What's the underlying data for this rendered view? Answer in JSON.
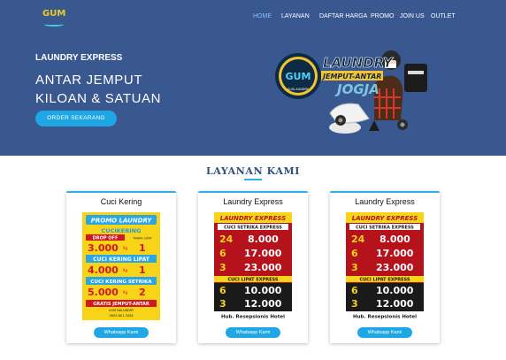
{
  "brand": {
    "logo_text": "GUM"
  },
  "nav": {
    "items": [
      {
        "label": "HOME",
        "active": true
      },
      {
        "label": "LAYANAN",
        "active": false
      },
      {
        "label": "DAFTAR HARGA",
        "active": false
      },
      {
        "label": "PROMO",
        "active": false
      },
      {
        "label": "JOIN US",
        "active": false
      },
      {
        "label": "OUTLET",
        "active": false
      }
    ]
  },
  "hero": {
    "subtitle": "LAUNDRY EXPRESS",
    "title": "ANTAR JEMPUT KILOAN & SATUAN",
    "cta_label": "ORDER SEKARANG",
    "illustration": {
      "badge_top": "GUM",
      "badge_bottom": "SUSLAUNDRY",
      "line1": "LAUNDRY",
      "line2": "JEMPUT-ANTAR",
      "line3": "JOGJA"
    }
  },
  "section": {
    "title": "LAYANAN KAMI"
  },
  "cards": [
    {
      "title": "Cuci Kering",
      "button": "Whatsapp Kami",
      "flyer": {
        "header": "PROMO LAUNDRY",
        "rows": [
          {
            "label": "CUCIKERING",
            "sub": "DROP OFF",
            "note": "TANPA LIPAT",
            "price": "3.000",
            "unit": "Kg",
            "min": "1"
          },
          {
            "label": "CUCI KERING LIPAT",
            "price": "4.000",
            "unit": "Kg",
            "min": "1"
          },
          {
            "label": "CUCI KERING SETRIKA",
            "price": "5.000",
            "unit": "Kg",
            "min": "2"
          }
        ],
        "footer": "GRATIS JEMPUT-ANTAR",
        "footer2": "GUM NALUNDRY",
        "phone": "0853-801-3426"
      }
    },
    {
      "title": "Laundry Express",
      "button": "Whatsapp Kami",
      "flyer": {
        "header": "LAUNDRY EXPRESS",
        "banner": "CUCI SETRIKA EXPRESS",
        "rows": [
          {
            "hours": "24",
            "price": "8.000"
          },
          {
            "hours": "6",
            "price": "17.000"
          },
          {
            "hours": "3",
            "price": "23.000"
          }
        ],
        "banner2": "CUCI LIPAT EXPRESS",
        "rows2": [
          {
            "hours": "6",
            "price": "10.000"
          },
          {
            "hours": "3",
            "price": "12.000"
          }
        ],
        "footer": "Hub. Resepsionis Hotel"
      }
    },
    {
      "title": "Laundry Express",
      "button": "Whatsapp Kami",
      "flyer": {
        "header": "LAUNDRY EXPRESS",
        "banner": "CUCI SETRIKA EXPRESS",
        "rows": [
          {
            "hours": "24",
            "price": "8.000"
          },
          {
            "hours": "6",
            "price": "17.000"
          },
          {
            "hours": "3",
            "price": "23.000"
          }
        ],
        "banner2": "CUCI LIPAT EXPRESS",
        "rows2": [
          {
            "hours": "6",
            "price": "10.000"
          },
          {
            "hours": "3",
            "price": "12.000"
          }
        ],
        "footer": "Hub. Resepsionis Hotel"
      }
    }
  ],
  "colors": {
    "hero_bg": "#3a5890",
    "accent": "#1fa7e5",
    "section_title": "#2f4d7d",
    "flyer_yellow": "#f7d418",
    "flyer_red": "#c8161d"
  }
}
